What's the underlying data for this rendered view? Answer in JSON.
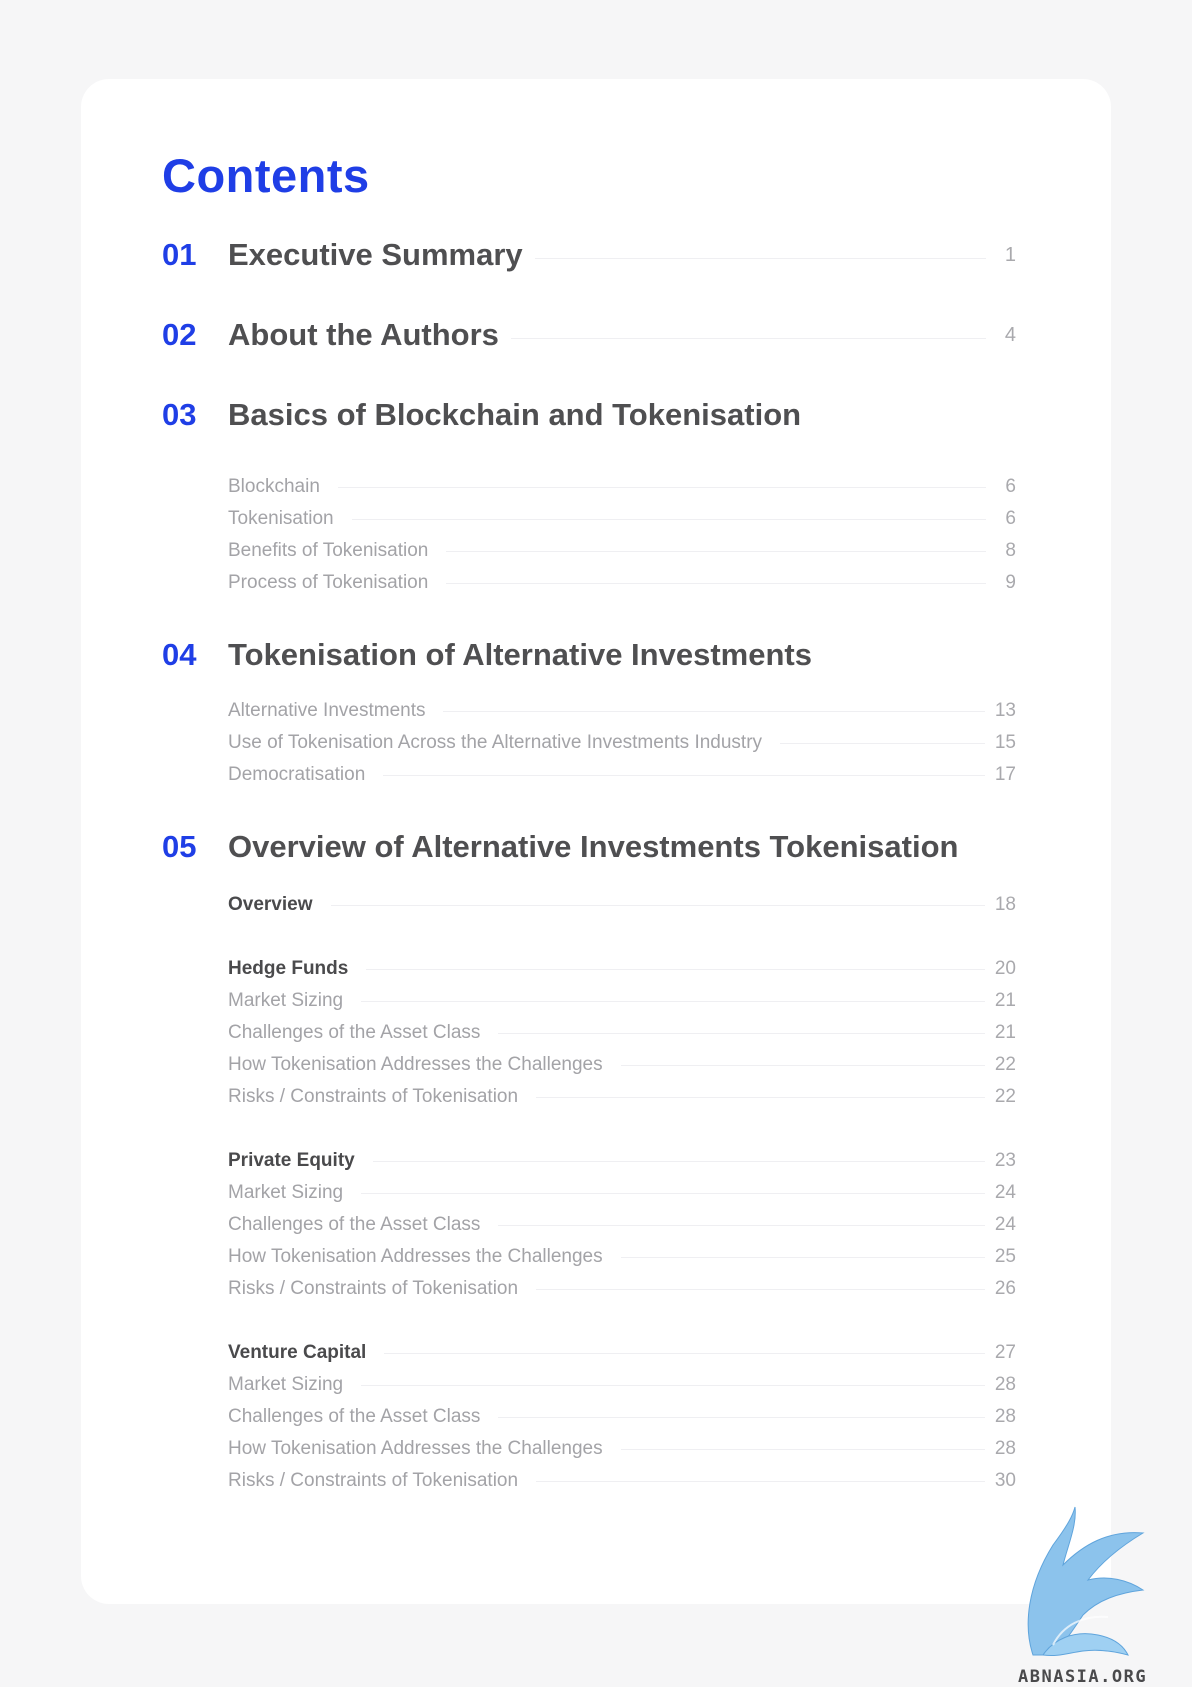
{
  "title": "Contents",
  "accent_color": "#1f3ee6",
  "sections": [
    {
      "number": "01",
      "title": "Executive Summary",
      "page": "1"
    },
    {
      "number": "02",
      "title": "About the Authors",
      "page": "4"
    },
    {
      "number": "03",
      "title": "Basics of Blockchain and Tokenisation",
      "items": [
        {
          "label": "Blockchain",
          "page": "6"
        },
        {
          "label": "Tokenisation",
          "page": "6"
        },
        {
          "label": "Benefits of Tokenisation",
          "page": "8"
        },
        {
          "label": "Process of Tokenisation",
          "page": "9"
        }
      ]
    },
    {
      "number": "04",
      "title": "Tokenisation of Alternative Investments",
      "items": [
        {
          "label": "Alternative Investments",
          "page": "13"
        },
        {
          "label": "Use of Tokenisation Across the Alternative Investments Industry",
          "page": "15"
        },
        {
          "label": "Democratisation",
          "page": "17"
        }
      ]
    },
    {
      "number": "05",
      "title": "Overview of Alternative Investments Tokenisation",
      "groups": [
        {
          "heading": {
            "label": "Overview",
            "page": "18"
          },
          "items": []
        },
        {
          "heading": {
            "label": "Hedge Funds",
            "page": "20"
          },
          "items": [
            {
              "label": "Market Sizing",
              "page": "21"
            },
            {
              "label": "Challenges of the Asset Class",
              "page": "21"
            },
            {
              "label": "How Tokenisation Addresses the Challenges",
              "page": "22"
            },
            {
              "label": "Risks / Constraints of Tokenisation",
              "page": "22"
            }
          ]
        },
        {
          "heading": {
            "label": "Private Equity",
            "page": "23"
          },
          "items": [
            {
              "label": "Market Sizing",
              "page": "24"
            },
            {
              "label": "Challenges of the Asset Class",
              "page": "24"
            },
            {
              "label": "How Tokenisation Addresses the Challenges",
              "page": "25"
            },
            {
              "label": "Risks / Constraints of Tokenisation",
              "page": "26"
            }
          ]
        },
        {
          "heading": {
            "label": "Venture Capital",
            "page": "27"
          },
          "items": [
            {
              "label": "Market Sizing",
              "page": "28"
            },
            {
              "label": "Challenges of the Asset Class",
              "page": "28"
            },
            {
              "label": "How Tokenisation Addresses the Challenges",
              "page": "28"
            },
            {
              "label": "Risks / Constraints of Tokenisation",
              "page": "30"
            }
          ]
        }
      ]
    }
  ],
  "watermark": {
    "text": "ABNASIA.ORG",
    "icon": "pegasus-logo-icon"
  }
}
